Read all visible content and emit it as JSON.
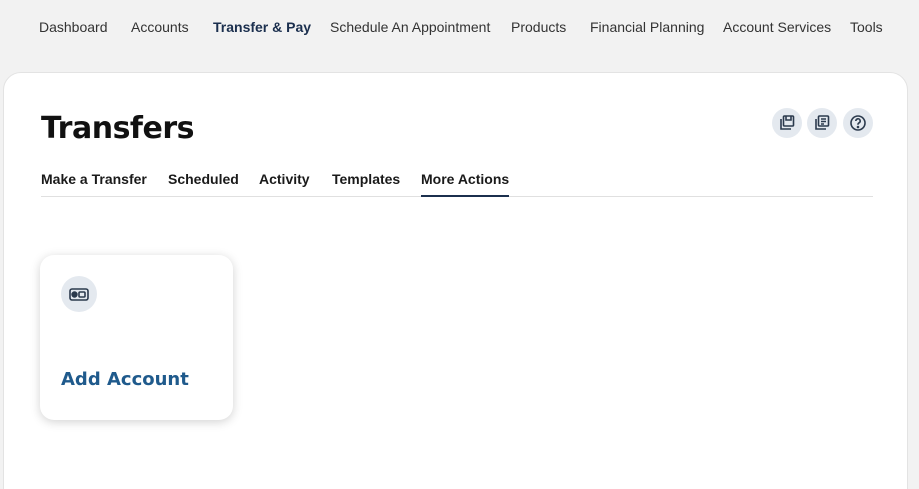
{
  "topnav": {
    "items": [
      {
        "label": "Dashboard"
      },
      {
        "label": "Accounts"
      },
      {
        "label": "Transfer & Pay"
      },
      {
        "label": "Schedule An Appointment"
      },
      {
        "label": "Products"
      },
      {
        "label": "Financial Planning"
      },
      {
        "label": "Account Services"
      },
      {
        "label": "Tools"
      }
    ],
    "active": "Transfer & Pay"
  },
  "page": {
    "title": "Transfers",
    "header_icons": [
      "save-icon",
      "document-icon",
      "help-icon"
    ]
  },
  "tabs": {
    "items": [
      {
        "label": "Make a Transfer"
      },
      {
        "label": "Scheduled"
      },
      {
        "label": "Activity"
      },
      {
        "label": "Templates"
      },
      {
        "label": "More Actions"
      }
    ],
    "active": "More Actions"
  },
  "actions": {
    "cards": [
      {
        "label": "Add Account",
        "icon": "account-card-icon"
      }
    ]
  },
  "colors": {
    "brand_navy": "#1b2f4e",
    "link_blue": "#1f5a8c",
    "icon_bg": "#e4e9ef",
    "page_bg": "#f2f2f2"
  }
}
